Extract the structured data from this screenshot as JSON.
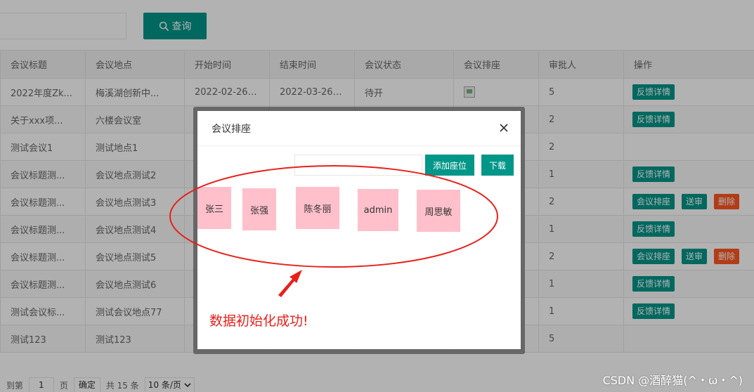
{
  "search": {
    "button_label": "查询",
    "icon": "search-icon"
  },
  "table": {
    "columns": [
      "会议标题",
      "会议地点",
      "开始时间",
      "结束时间",
      "会议状态",
      "会议排座",
      "审批人",
      "操作"
    ],
    "rows": [
      {
        "title": "2022年度Zk...",
        "place": "梅溪湖创新中...",
        "start": "2022-02-26 ...",
        "end": "2022-03-26 ...",
        "status": "待开",
        "seat_img": true,
        "approver": "5",
        "ops": [
          "feedback"
        ]
      },
      {
        "title": "关于xxx项...",
        "place": "六楼会议室",
        "start": "",
        "end": "",
        "status": "",
        "seat_img": false,
        "approver": "2",
        "ops": [
          "feedback"
        ]
      },
      {
        "title": "测试会议1",
        "place": "测试地点1",
        "start": "",
        "end": "",
        "status": "",
        "seat_img": false,
        "approver": "2",
        "ops": []
      },
      {
        "title": "会议标题测...",
        "place": "会议地点测试2",
        "start": "",
        "end": "",
        "status": "",
        "seat_img": false,
        "approver": "1",
        "ops": [
          "feedback"
        ]
      },
      {
        "title": "会议标题测...",
        "place": "会议地点测试3",
        "start": "",
        "end": "",
        "status": "",
        "seat_img": false,
        "approver": "2",
        "ops": [
          "seating",
          "review",
          "delete"
        ]
      },
      {
        "title": "会议标题测...",
        "place": "会议地点测试4",
        "start": "",
        "end": "",
        "status": "",
        "seat_img": false,
        "approver": "1",
        "ops": [
          "feedback"
        ]
      },
      {
        "title": "会议标题测...",
        "place": "会议地点测试5",
        "start": "",
        "end": "",
        "status": "",
        "seat_img": false,
        "approver": "2",
        "ops": [
          "seating",
          "review",
          "delete"
        ]
      },
      {
        "title": "会议标题测...",
        "place": "会议地点测试6",
        "start": "",
        "end": "",
        "status": "",
        "seat_img": false,
        "approver": "1",
        "ops": [
          "feedback"
        ]
      },
      {
        "title": "测试会议标...",
        "place": "测试会议地点77",
        "start": "",
        "end": "",
        "status": "",
        "seat_img": false,
        "approver": "1",
        "ops": [
          "feedback"
        ]
      },
      {
        "title": "测试123",
        "place": "测试123",
        "start": "",
        "end": "",
        "status": "",
        "seat_img": false,
        "approver": "5",
        "ops": []
      }
    ],
    "op_labels": {
      "feedback": "反馈详情",
      "seating": "会议排座",
      "review": "送审",
      "delete": "删除"
    }
  },
  "pager": {
    "goto_label": "到第",
    "page_value": "1",
    "page_unit": "页",
    "confirm_label": "确定",
    "total_label": "共 15 条",
    "page_size": "10 条/页"
  },
  "dialog": {
    "title": "会议排座",
    "add_seat_label": "添加座位",
    "download_label": "下载",
    "seats": [
      "张三",
      "张强",
      "陈冬丽",
      "admin",
      "周思敏"
    ]
  },
  "annotation": {
    "text": "数据初始化成功!"
  },
  "watermark": "CSDN @酒醉猫(^・ω・^)",
  "colors": {
    "primary": "#009688",
    "danger": "#ff5722",
    "seat": "#ffc0cb",
    "annotation": "#e8201a"
  }
}
